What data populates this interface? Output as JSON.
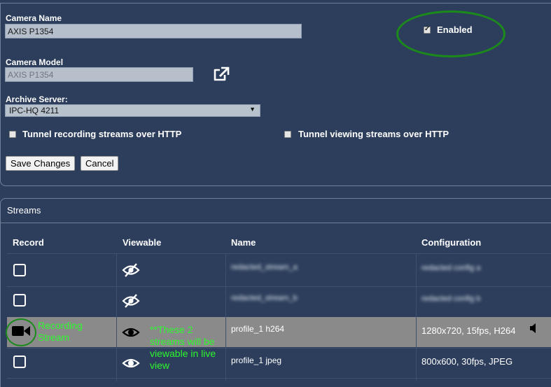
{
  "camera": {
    "name_label": "Camera Name",
    "name_value": "AXIS P1354",
    "enabled_label": "Enabled",
    "enabled": true,
    "model_label": "Camera Model",
    "model_value": "AXIS P1354",
    "archive_label": "Archive Server:",
    "archive_value": "IPC-HQ 4211",
    "tunnel_recording_label": "Tunnel recording streams over HTTP",
    "tunnel_viewing_label": "Tunnel viewing streams over HTTP",
    "save_label": "Save Changes",
    "cancel_label": "Cancel"
  },
  "streams": {
    "title": "Streams",
    "headers": {
      "record": "Record",
      "viewable": "Viewable",
      "name": "Name",
      "configuration": "Configuration"
    },
    "rows": [
      {
        "name": "redacted_stream_a",
        "config": "redacted config a",
        "record_icon": "checkbox-icon",
        "view_icon": "eye-slash-icon"
      },
      {
        "name": "redacted_stream_b",
        "config": "redacted config b",
        "record_icon": "checkbox-icon",
        "view_icon": "eye-slash-icon"
      },
      {
        "name": "profile_1 h264",
        "config": "1280x720, 15fps, H264",
        "record_icon": "video-camera-icon",
        "view_icon": "eye-icon"
      },
      {
        "name": "profile_1 jpeg",
        "config": "800x600, 30fps, JPEG",
        "record_icon": "checkbox-icon",
        "view_icon": "eye-icon"
      }
    ]
  },
  "annotations": {
    "recording_note": "Recording Stream",
    "viewable_note": "**These 2 streams will be viewable in live view",
    "highlight_color": "#1b8a1b",
    "note_color": "#2ef82e"
  }
}
